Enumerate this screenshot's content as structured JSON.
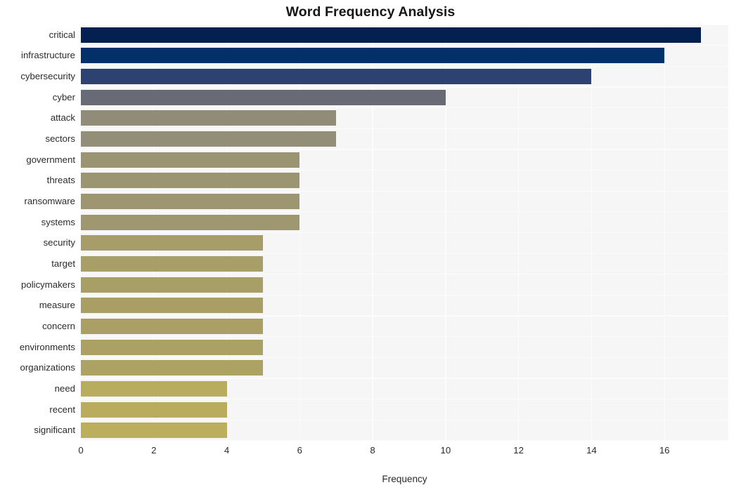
{
  "chart_data": {
    "type": "bar",
    "orientation": "horizontal",
    "title": "Word Frequency Analysis",
    "xlabel": "Frequency",
    "ylabel": "",
    "xlim": [
      0,
      17.75
    ],
    "xticks": [
      0,
      2,
      4,
      6,
      8,
      10,
      12,
      14,
      16
    ],
    "xtick_labels": [
      "0",
      "2",
      "4",
      "6",
      "8",
      "10",
      "12",
      "14",
      "16"
    ],
    "grid": true,
    "legend": false,
    "categories": [
      "critical",
      "infrastructure",
      "cybersecurity",
      "cyber",
      "attack",
      "sectors",
      "government",
      "threats",
      "ransomware",
      "systems",
      "security",
      "target",
      "policymakers",
      "measure",
      "concern",
      "environments",
      "organizations",
      "need",
      "recent",
      "significant"
    ],
    "values": [
      17,
      16,
      14,
      10,
      7,
      7,
      6,
      6,
      6,
      6,
      5,
      5,
      5,
      5,
      5,
      5,
      5,
      4,
      4,
      4
    ],
    "bar_colors": [
      "#042050",
      "#033069",
      "#2e4272",
      "#686a75",
      "#918c77",
      "#938e78",
      "#9b9472",
      "#9c9571",
      "#9d9670",
      "#9e976f",
      "#a69d69",
      "#a79e68",
      "#a89f67",
      "#a99f66",
      "#aaa065",
      "#aba164",
      "#aca263",
      "#b8ac5e",
      "#b9ad5d",
      "#bbae5c"
    ],
    "plot_background": "#f6f6f7",
    "grid_color": "#fcfcfd",
    "text_color": "#2b2b2b",
    "title_color": "#161616"
  }
}
